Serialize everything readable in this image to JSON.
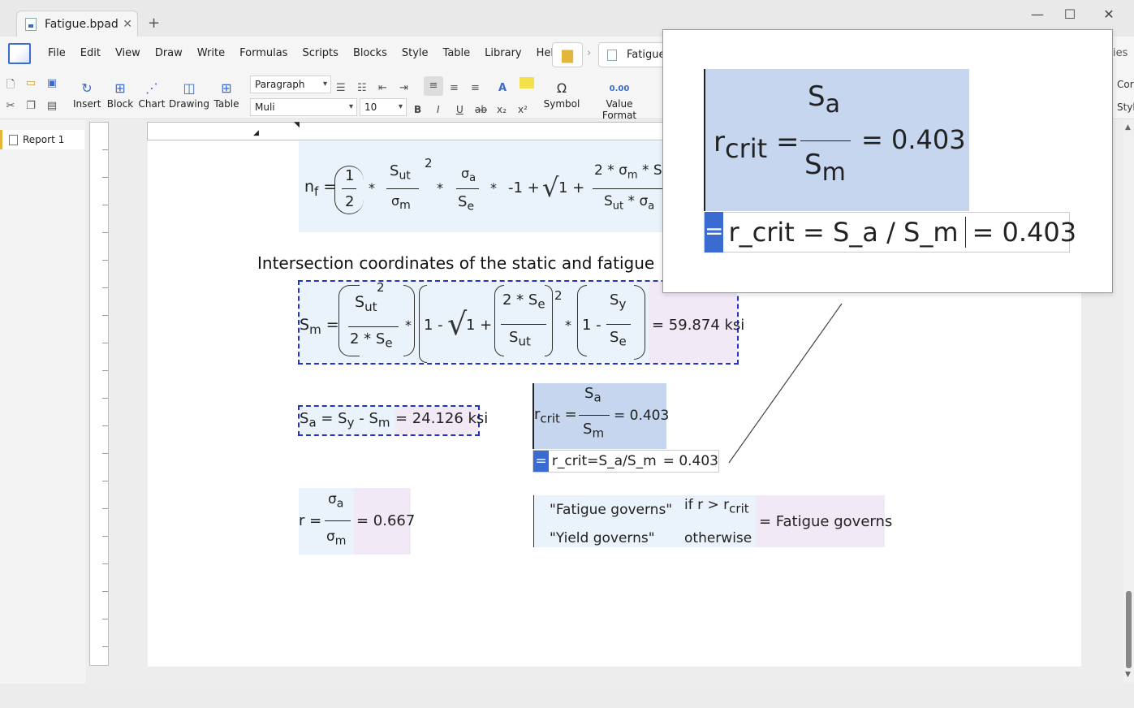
{
  "window": {
    "tab_title": "Fatigue.bpad",
    "tab_close": "✕",
    "new_tab": "+",
    "minimize": "—",
    "maximize": "☐",
    "close": "✕"
  },
  "menu": {
    "items": [
      "File",
      "Edit",
      "View",
      "Draw",
      "Write",
      "Formulas",
      "Scripts",
      "Blocks",
      "Style",
      "Table",
      "Library",
      "Help"
    ],
    "breadcrumb_file": "Fatigue",
    "right_cut_label": "ies"
  },
  "toolbar": {
    "insert_label": "Insert",
    "block_label": "Block",
    "chart_label": "Chart",
    "drawing_label": "Drawing",
    "table_label": "Table",
    "paragraph_style": "Paragraph",
    "font_name": "Muli",
    "font_size": "10",
    "symbol_label": "Symbol",
    "symbol_glyph": "Ω",
    "value_format_label": "Value Format",
    "value_format_glyph": "0.00",
    "right_cut_top": "Cor",
    "right_cut_bottom": "Styl",
    "bold": "B",
    "italic": "I",
    "underline": "U",
    "strike": "ab",
    "subscript": "x₂",
    "superscript": "x²"
  },
  "navigator": {
    "report_label": "Report 1"
  },
  "document": {
    "heading": "Intersection coordinates of the static and fatigue",
    "nf": {
      "lhs": "n",
      "lhs_sub": "f",
      "half_num": "1",
      "half_den": "2",
      "sut": "S",
      "sut_sub": "ut",
      "sigma_m": "σ",
      "sigma_m_sub": "m",
      "exp2": "2",
      "sigma_a": "σ",
      "sigma_a_sub": "a",
      "se": "S",
      "se_sub": "e",
      "minus_one": "-1 +",
      "one_plus": "1 +",
      "frac_num": "2 * σ",
      "frac_num_sub": "m",
      "frac_num_tail": " * S",
      "frac_den": "S",
      "frac_den_sub": "ut",
      "frac_den_tail": " * σ",
      "frac_den_tail_sub": "a"
    },
    "sm": {
      "lhs": "S",
      "lhs_sub": "m",
      "sut": "S",
      "sut_sub": "ut",
      "sq": "2",
      "den": "2 * S",
      "den_sub": "e",
      "one_minus": "1 -",
      "one_plus": "1 +",
      "inner_num": "2 * S",
      "inner_num_sub": "e",
      "inner_den": "S",
      "inner_den_sub": "ut",
      "exp2": "2",
      "last": "1 -",
      "sy": "S",
      "sy_sub": "y",
      "se": "S",
      "se_sub": "e",
      "result": "= 59.874 ksi"
    },
    "sa": {
      "lhs": "S",
      "lhs_sub": "a",
      "sy": "S",
      "sy_sub": "y",
      "sm": "S",
      "sm_sub": "m",
      "result": "= 24.126 ksi"
    },
    "rcrit": {
      "lhs": "r",
      "lhs_sub": "crit",
      "num": "S",
      "num_sub": "a",
      "den": "S",
      "den_sub": "m",
      "result": "= 0.403",
      "source_text": "r_crit=S_a/S_m",
      "source_result": "= 0.403",
      "eq_button": "="
    },
    "r": {
      "lhs": "r =",
      "num": "σ",
      "num_sub": "a",
      "den": "σ",
      "den_sub": "m",
      "result": "= 0.667"
    },
    "governs": {
      "case1": "\"Fatigue governs\"",
      "cond1": "if r > r",
      "cond1_sub": "crit",
      "case2": "\"Yield governs\"",
      "cond2": "otherwise",
      "result": "= Fatigue governs"
    }
  },
  "popup": {
    "lhs": "r",
    "lhs_sub": "crit",
    "num": "S",
    "num_sub": "a",
    "den": "S",
    "den_sub": "m",
    "result": "= 0.403",
    "eq_button": "=",
    "source_text": "r_crit = S_a / S_m",
    "source_result": "= 0.403"
  }
}
